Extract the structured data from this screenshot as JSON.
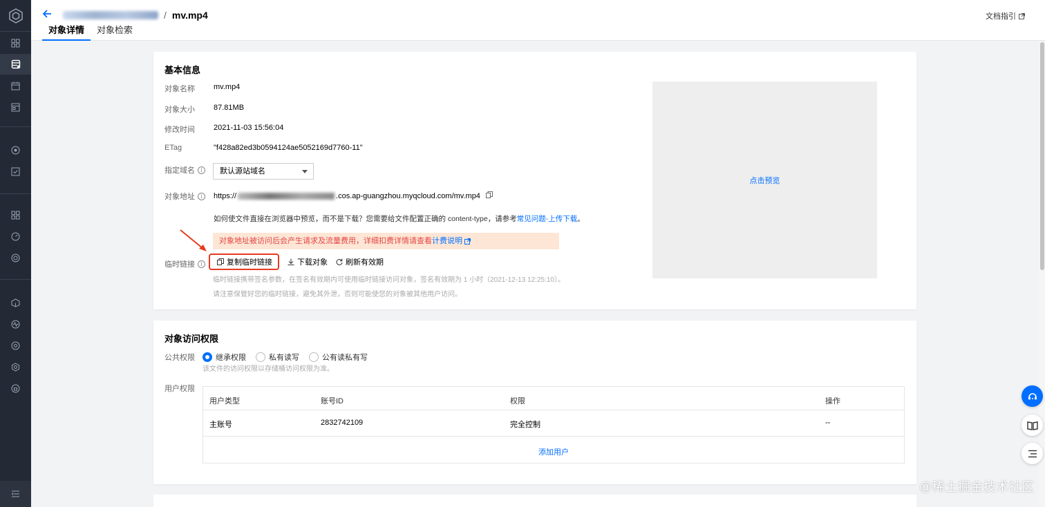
{
  "header": {
    "title": "mv.mp4",
    "breadcrumb_sep": "/",
    "tabs": [
      {
        "label": "对象详情",
        "active": true
      },
      {
        "label": "对象检索",
        "active": false
      }
    ],
    "doc_link": "文档指引"
  },
  "basic_info": {
    "title": "基本信息",
    "rows": {
      "name": {
        "label": "对象名称",
        "value": "mv.mp4"
      },
      "size": {
        "label": "对象大小",
        "value": "87.81MB"
      },
      "modified": {
        "label": "修改时间",
        "value": "2021-11-03 15:56:04"
      },
      "etag": {
        "label": "ETag",
        "value": "\"f428a82ed3b0594124ae5052169d7760-11\""
      },
      "domain": {
        "label": "指定域名",
        "value": "默认源站域名"
      },
      "address": {
        "label": "对象地址",
        "prefix": "https://",
        "suffix": ".cos.ap-guangzhou.myqcloud.com/mv.mp4"
      }
    },
    "preview_note": "如何使文件直接在浏览器中预览，而不是下载？您需要给文件配置正确的 content-type，请参考",
    "preview_note_link": "常见问题-上传下载",
    "preview_note_end": "。",
    "warning": "对象地址被访问后会产生请求及流量费用，详细扣费详情请查看",
    "warning_link": "计费说明",
    "temp_link_label": "临时链接",
    "actions": {
      "copy": "复制临时链接",
      "download": "下载对象",
      "refresh": "刷新有效期"
    },
    "hint1": "临时链接携带签名参数，在签名有效期内可使用临时链接访问对象，签名有效期为 1 小时（2021-12-13 12:25:10）。",
    "hint2": "请注意保管好您的临时链接，避免其外泄，否则可能使您的对象被其他用户访问。",
    "preview_button": "点击预览"
  },
  "access": {
    "title": "对象访问权限",
    "public_label": "公共权限",
    "options": [
      {
        "label": "继承权限",
        "selected": true
      },
      {
        "label": "私有读写",
        "selected": false
      },
      {
        "label": "公有读私有写",
        "selected": false
      }
    ],
    "public_hint": "该文件的访问权限以存储桶访问权限为准。",
    "user_label": "用户权限",
    "table": {
      "headers": [
        "用户类型",
        "账号ID",
        "权限",
        "操作"
      ],
      "rows": [
        [
          "主账号",
          "2832742109",
          "完全控制",
          "--"
        ]
      ]
    },
    "add_user": "添加用户"
  },
  "watermark": "@稀土掘金技术社区",
  "colors": {
    "accent": "#006eff",
    "warning_bg": "#fde6d5",
    "warning_text": "#e54545",
    "highlight": "#e53a1f",
    "sidebar": "#242a35"
  }
}
